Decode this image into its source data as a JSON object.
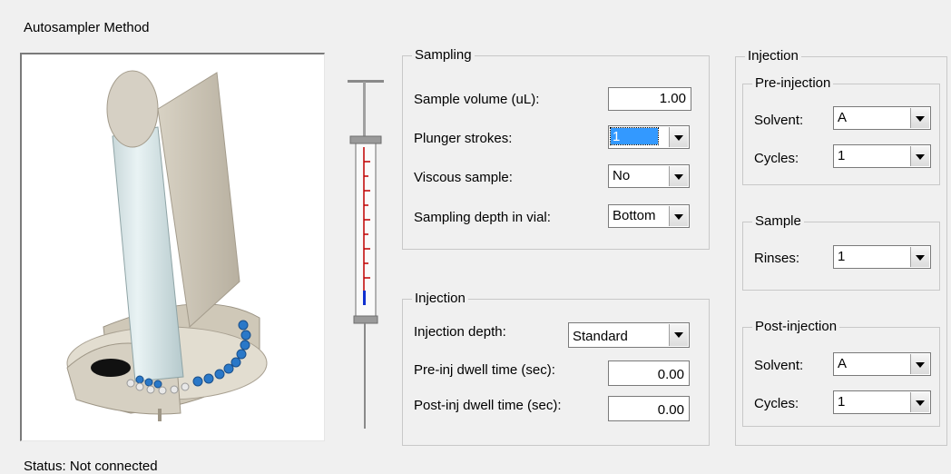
{
  "window": {
    "title": "Autosampler Method"
  },
  "status": {
    "text": "Status: Not connected"
  },
  "sampling": {
    "legend": "Sampling",
    "sample_volume_label": "Sample volume (uL):",
    "sample_volume_value": "1.00",
    "plunger_strokes_label": "Plunger strokes:",
    "plunger_strokes_value": "1",
    "viscous_label": "Viscous sample:",
    "viscous_value": "No",
    "depth_label": "Sampling depth in vial:",
    "depth_value": "Bottom"
  },
  "injection_left": {
    "legend": "Injection",
    "depth_label": "Injection depth:",
    "depth_value": "Standard",
    "pre_dwell_label": "Pre-inj dwell time (sec):",
    "pre_dwell_value": "0.00",
    "post_dwell_label": "Post-inj dwell time (sec):",
    "post_dwell_value": "0.00"
  },
  "injection_right": {
    "legend": "Injection",
    "pre": {
      "legend": "Pre-injection",
      "solvent_label": "Solvent:",
      "solvent_value": "A",
      "cycles_label": "Cycles:",
      "cycles_value": "1"
    },
    "sample": {
      "legend": "Sample",
      "rinses_label": "Rinses:",
      "rinses_value": "1"
    },
    "post": {
      "legend": "Post-injection",
      "solvent_label": "Solvent:",
      "solvent_value": "A",
      "cycles_label": "Cycles:",
      "cycles_value": "1"
    }
  },
  "colors": {
    "window_bg": "#f0f0f0",
    "selection": "#3399ff",
    "syringe_scale": "#c00000",
    "syringe_fill": "#1030d0"
  },
  "icons": {
    "combo_arrow": "chevron-down-icon"
  }
}
